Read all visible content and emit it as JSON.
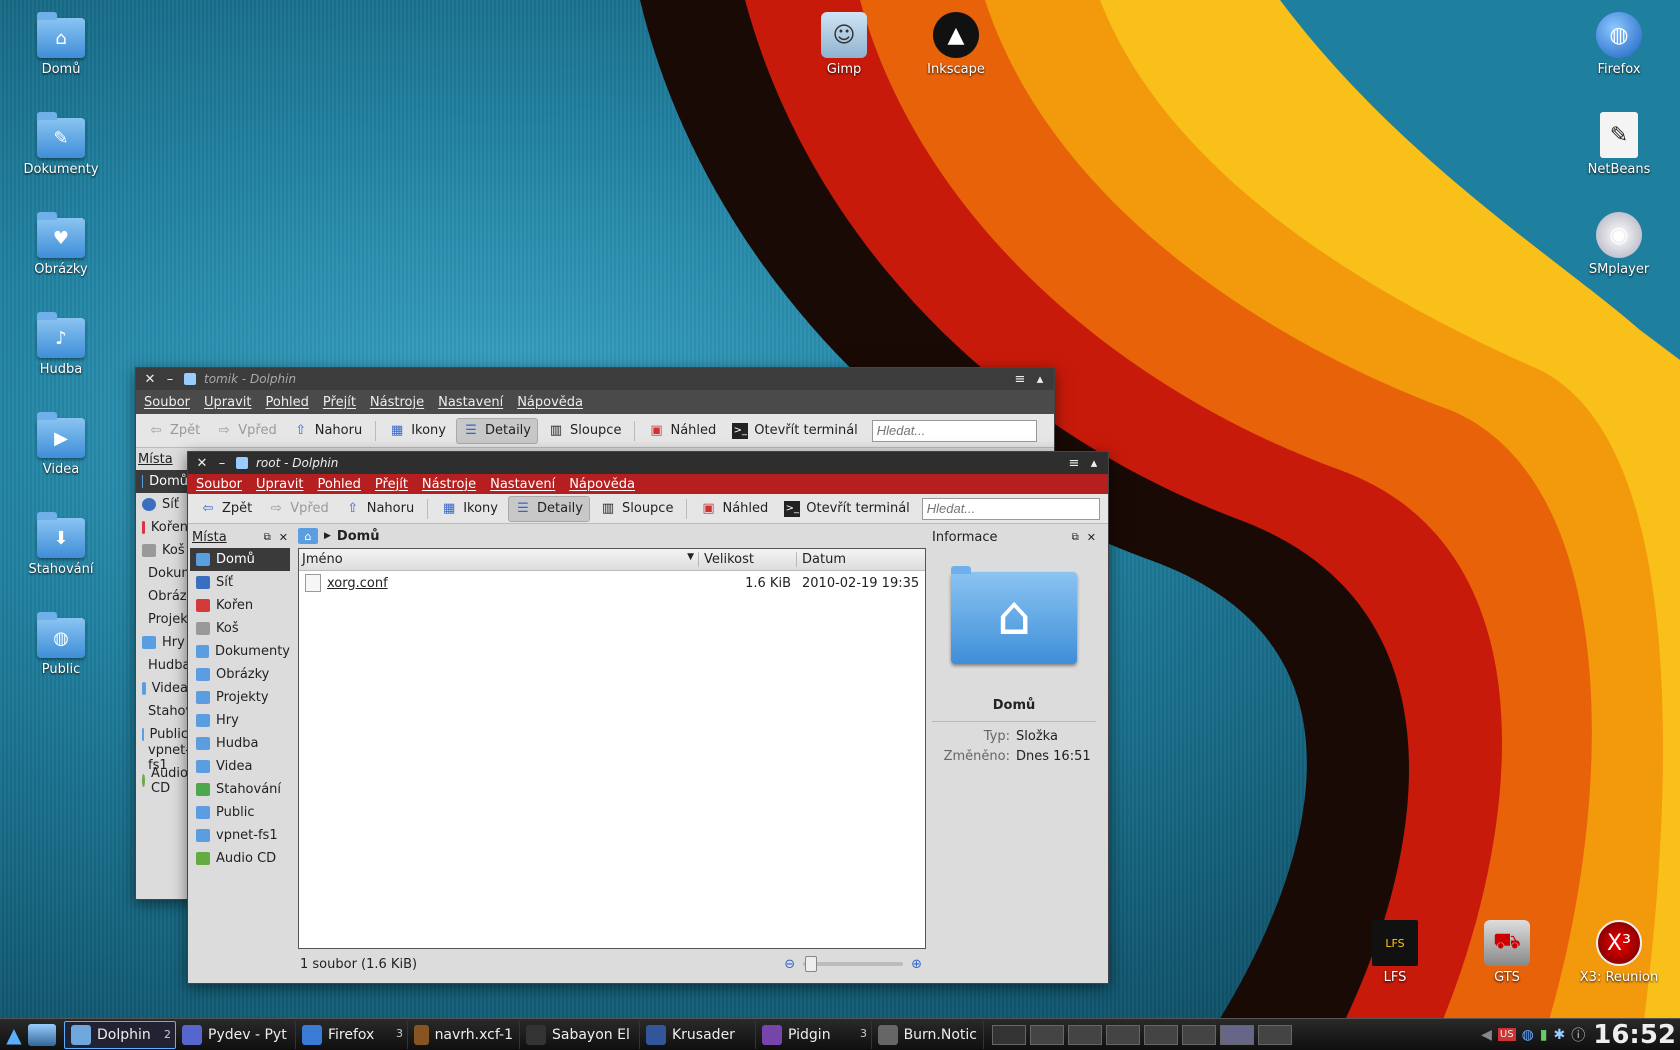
{
  "desktop": {
    "left_icons": [
      {
        "label": "Domů",
        "glyph": "⌂"
      },
      {
        "label": "Dokumenty",
        "glyph": "✎"
      },
      {
        "label": "Obrázky",
        "glyph": "♥"
      },
      {
        "label": "Hudba",
        "glyph": "♪"
      },
      {
        "label": "Videa",
        "glyph": "▶"
      },
      {
        "label": "Stahování",
        "glyph": "⬇"
      },
      {
        "label": "Public",
        "glyph": "◍"
      }
    ],
    "top_icons": [
      {
        "label": "Gimp"
      },
      {
        "label": "Inkscape"
      }
    ],
    "right_icons": [
      {
        "label": "Firefox"
      },
      {
        "label": "NetBeans"
      },
      {
        "label": "SMplayer"
      }
    ],
    "bottom_icons": [
      {
        "label": "LFS"
      },
      {
        "label": "GTS"
      },
      {
        "label": "X3: Reunion"
      }
    ]
  },
  "back_window": {
    "title": "tomik - Dolphin",
    "menu": [
      "Soubor",
      "Upravit",
      "Pohled",
      "Přejít",
      "Nástroje",
      "Nastavení",
      "Nápověda"
    ],
    "toolbar": {
      "back": "Zpět",
      "forward": "Vpřed",
      "up": "Nahoru",
      "icons": "Ikony",
      "details": "Detaily",
      "columns": "Sloupce",
      "preview": "Náhled",
      "terminal": "Otevřít terminál",
      "search_placeholder": "Hledat..."
    },
    "places_title": "Místa",
    "places": [
      "Domů",
      "Síť",
      "Kořen",
      "Koš",
      "Dokumenty",
      "Obrázky",
      "Projekty",
      "Hry",
      "Hudba",
      "Videa",
      "Stahování",
      "Public",
      "vpnet-fs1",
      "Audio CD"
    ]
  },
  "front_window": {
    "title": "root - Dolphin",
    "menu": [
      "Soubor",
      "Upravit",
      "Pohled",
      "Přejít",
      "Nástroje",
      "Nastavení",
      "Nápověda"
    ],
    "toolbar": {
      "back": "Zpět",
      "forward": "Vpřed",
      "up": "Nahoru",
      "icons": "Ikony",
      "details": "Detaily",
      "columns": "Sloupce",
      "preview": "Náhled",
      "terminal": "Otevřít terminál",
      "search_placeholder": "Hledat..."
    },
    "places_title": "Místa",
    "places": [
      {
        "label": "Domů",
        "color": "#5a9de0",
        "selected": true
      },
      {
        "label": "Síť",
        "color": "#3a6fc0"
      },
      {
        "label": "Kořen",
        "color": "#d43a3a"
      },
      {
        "label": "Koš",
        "color": "#999999"
      },
      {
        "label": "Dokumenty",
        "color": "#5a9de0"
      },
      {
        "label": "Obrázky",
        "color": "#5a9de0"
      },
      {
        "label": "Projekty",
        "color": "#5a9de0"
      },
      {
        "label": "Hry",
        "color": "#5a9de0"
      },
      {
        "label": "Hudba",
        "color": "#5a9de0"
      },
      {
        "label": "Videa",
        "color": "#5a9de0"
      },
      {
        "label": "Stahování",
        "color": "#4ca84c"
      },
      {
        "label": "Public",
        "color": "#5a9de0"
      },
      {
        "label": "vpnet-fs1",
        "color": "#5a9de0"
      },
      {
        "label": "Audio CD",
        "color": "#66aa44"
      }
    ],
    "breadcrumb": "Domů",
    "columns": {
      "name": "Jméno",
      "size": "Velikost",
      "date": "Datum"
    },
    "files": [
      {
        "name": "xorg.conf",
        "size": "1.6 KiB",
        "date": "2010-02-19 19:35"
      }
    ],
    "status": "1 soubor (1.6 KiB)",
    "info": {
      "title": "Informace",
      "name": "Domů",
      "type_label": "Typ:",
      "type_value": "Složka",
      "modified_label": "Změněno:",
      "modified_value": "Dnes 16:51"
    },
    "menubar_color": "#b51f1f"
  },
  "taskbar": {
    "tasks": [
      {
        "label": "Dolphin",
        "count": "2",
        "active": true,
        "color": "#6fa8dc"
      },
      {
        "label": "Pydev - Pyt",
        "count": "",
        "color": "#5566cc"
      },
      {
        "label": "Firefox",
        "count": "3",
        "color": "#3a7bd5"
      },
      {
        "label": "navrh.xcf-1",
        "count": "",
        "color": "#885522"
      },
      {
        "label": "Sabayon El",
        "count": "",
        "color": "#333333"
      },
      {
        "label": "Krusader",
        "count": "",
        "color": "#335599"
      },
      {
        "label": "Pidgin",
        "count": "3",
        "color": "#7744aa"
      },
      {
        "label": "Burn.Notic",
        "count": "",
        "color": "#666666"
      }
    ],
    "clock": "16:52"
  }
}
